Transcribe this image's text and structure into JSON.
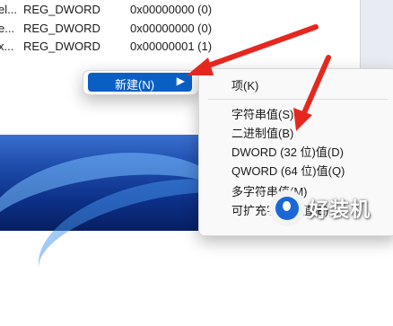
{
  "registry_rows": [
    {
      "name": "el...",
      "type": "REG_DWORD",
      "data": "0x00000000 (0)"
    },
    {
      "name": "e...",
      "type": "REG_DWORD",
      "data": "0x00000000 (0)"
    },
    {
      "name": "x...",
      "type": "REG_DWORD",
      "data": "0x00000001 (1)"
    }
  ],
  "context_menu": {
    "new_label": "新建(N)",
    "submenu_arrow": "▶"
  },
  "new_submenu": {
    "key": "项(K)",
    "string_value": "字符串值(S)",
    "binary_value": "二进制值(B)",
    "dword_value": "DWORD (32 位)值(D)",
    "qword_value": "QWORD (64 位)值(Q)",
    "multi_string_value": "多字符串值(M)",
    "expandable_string_value": "可扩充字符串值(E)"
  },
  "watermark": {
    "text": "好装机"
  },
  "colors": {
    "highlight": "#0a5fc5",
    "annotation_red": "#e5281f",
    "desktop_blue": "#1c4aa8"
  }
}
